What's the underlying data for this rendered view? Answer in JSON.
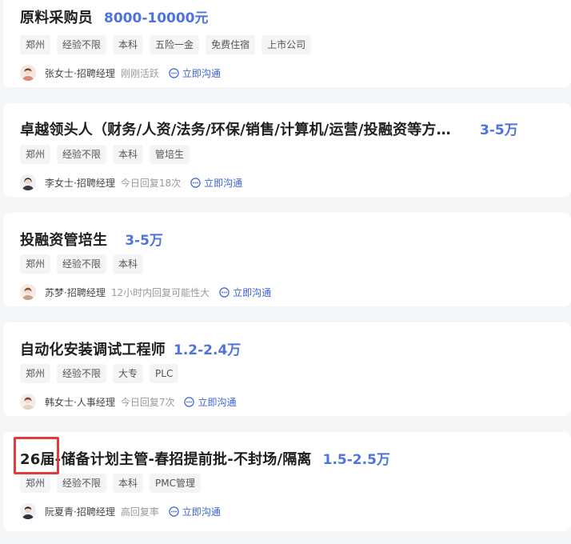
{
  "jobs": [
    {
      "title": "原料采购员",
      "salary": "8000-10000元",
      "tags": [
        "郑州",
        "经验不限",
        "本科",
        "五险一金",
        "免费住宿",
        "上市公司"
      ],
      "recruiter": "张女士·招聘经理",
      "active": "刚刚活跃",
      "chat": "立即沟通"
    },
    {
      "title": "卓越领头人（财务/人资/法务/环保/销售/计算机/运营/投融资等方向）",
      "salary": "3-5万",
      "tags": [
        "郑州",
        "经验不限",
        "本科",
        "管培生"
      ],
      "recruiter": "李女士·招聘经理",
      "active": "今日回复18次",
      "chat": "立即沟通"
    },
    {
      "title": "投融资管培生",
      "salary": "3-5万",
      "tags": [
        "郑州",
        "经验不限",
        "本科"
      ],
      "recruiter": "苏梦·招聘经理",
      "active": "12小时内回复可能性大",
      "chat": "立即沟通"
    },
    {
      "title": "自动化安装调试工程师",
      "salary": "1.2-2.4万",
      "tags": [
        "郑州",
        "经验不限",
        "大专",
        "PLC"
      ],
      "recruiter": "韩女士·人事经理",
      "active": "今日回复7次",
      "chat": "立即沟通"
    },
    {
      "title": "26届-储备计划主管-春招提前批-不封场/隔离",
      "salary": "1.5-2.5万",
      "tags": [
        "郑州",
        "经验不限",
        "本科",
        "PMC管理"
      ],
      "recruiter": "阮夏青·招聘经理",
      "active": "高回复率",
      "chat": "立即沟通"
    }
  ],
  "colors": {
    "salary": "#4e73df",
    "chat": "#3d62d8",
    "highlight": "#e63939"
  },
  "icons": {
    "chat": "chat-bubble-icon",
    "avatar": "avatar-icon"
  }
}
